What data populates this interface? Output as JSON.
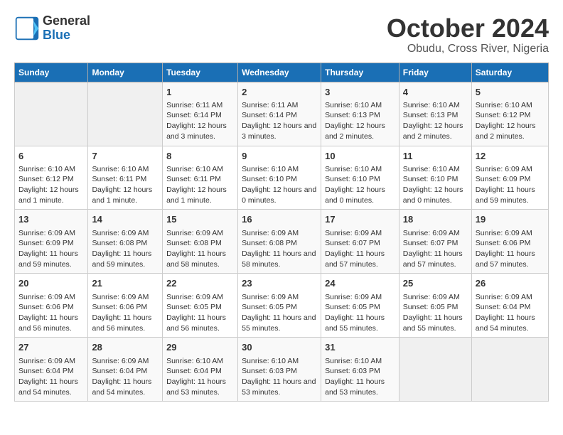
{
  "header": {
    "logo_line1": "General",
    "logo_line2": "Blue",
    "month": "October 2024",
    "location": "Obudu, Cross River, Nigeria"
  },
  "weekdays": [
    "Sunday",
    "Monday",
    "Tuesday",
    "Wednesday",
    "Thursday",
    "Friday",
    "Saturday"
  ],
  "weeks": [
    [
      {
        "day": "",
        "info": ""
      },
      {
        "day": "",
        "info": ""
      },
      {
        "day": "1",
        "info": "Sunrise: 6:11 AM\nSunset: 6:14 PM\nDaylight: 12 hours and 3 minutes."
      },
      {
        "day": "2",
        "info": "Sunrise: 6:11 AM\nSunset: 6:14 PM\nDaylight: 12 hours and 3 minutes."
      },
      {
        "day": "3",
        "info": "Sunrise: 6:10 AM\nSunset: 6:13 PM\nDaylight: 12 hours and 2 minutes."
      },
      {
        "day": "4",
        "info": "Sunrise: 6:10 AM\nSunset: 6:13 PM\nDaylight: 12 hours and 2 minutes."
      },
      {
        "day": "5",
        "info": "Sunrise: 6:10 AM\nSunset: 6:12 PM\nDaylight: 12 hours and 2 minutes."
      }
    ],
    [
      {
        "day": "6",
        "info": "Sunrise: 6:10 AM\nSunset: 6:12 PM\nDaylight: 12 hours and 1 minute."
      },
      {
        "day": "7",
        "info": "Sunrise: 6:10 AM\nSunset: 6:11 PM\nDaylight: 12 hours and 1 minute."
      },
      {
        "day": "8",
        "info": "Sunrise: 6:10 AM\nSunset: 6:11 PM\nDaylight: 12 hours and 1 minute."
      },
      {
        "day": "9",
        "info": "Sunrise: 6:10 AM\nSunset: 6:10 PM\nDaylight: 12 hours and 0 minutes."
      },
      {
        "day": "10",
        "info": "Sunrise: 6:10 AM\nSunset: 6:10 PM\nDaylight: 12 hours and 0 minutes."
      },
      {
        "day": "11",
        "info": "Sunrise: 6:10 AM\nSunset: 6:10 PM\nDaylight: 12 hours and 0 minutes."
      },
      {
        "day": "12",
        "info": "Sunrise: 6:09 AM\nSunset: 6:09 PM\nDaylight: 11 hours and 59 minutes."
      }
    ],
    [
      {
        "day": "13",
        "info": "Sunrise: 6:09 AM\nSunset: 6:09 PM\nDaylight: 11 hours and 59 minutes."
      },
      {
        "day": "14",
        "info": "Sunrise: 6:09 AM\nSunset: 6:08 PM\nDaylight: 11 hours and 59 minutes."
      },
      {
        "day": "15",
        "info": "Sunrise: 6:09 AM\nSunset: 6:08 PM\nDaylight: 11 hours and 58 minutes."
      },
      {
        "day": "16",
        "info": "Sunrise: 6:09 AM\nSunset: 6:08 PM\nDaylight: 11 hours and 58 minutes."
      },
      {
        "day": "17",
        "info": "Sunrise: 6:09 AM\nSunset: 6:07 PM\nDaylight: 11 hours and 57 minutes."
      },
      {
        "day": "18",
        "info": "Sunrise: 6:09 AM\nSunset: 6:07 PM\nDaylight: 11 hours and 57 minutes."
      },
      {
        "day": "19",
        "info": "Sunrise: 6:09 AM\nSunset: 6:06 PM\nDaylight: 11 hours and 57 minutes."
      }
    ],
    [
      {
        "day": "20",
        "info": "Sunrise: 6:09 AM\nSunset: 6:06 PM\nDaylight: 11 hours and 56 minutes."
      },
      {
        "day": "21",
        "info": "Sunrise: 6:09 AM\nSunset: 6:06 PM\nDaylight: 11 hours and 56 minutes."
      },
      {
        "day": "22",
        "info": "Sunrise: 6:09 AM\nSunset: 6:05 PM\nDaylight: 11 hours and 56 minutes."
      },
      {
        "day": "23",
        "info": "Sunrise: 6:09 AM\nSunset: 6:05 PM\nDaylight: 11 hours and 55 minutes."
      },
      {
        "day": "24",
        "info": "Sunrise: 6:09 AM\nSunset: 6:05 PM\nDaylight: 11 hours and 55 minutes."
      },
      {
        "day": "25",
        "info": "Sunrise: 6:09 AM\nSunset: 6:05 PM\nDaylight: 11 hours and 55 minutes."
      },
      {
        "day": "26",
        "info": "Sunrise: 6:09 AM\nSunset: 6:04 PM\nDaylight: 11 hours and 54 minutes."
      }
    ],
    [
      {
        "day": "27",
        "info": "Sunrise: 6:09 AM\nSunset: 6:04 PM\nDaylight: 11 hours and 54 minutes."
      },
      {
        "day": "28",
        "info": "Sunrise: 6:09 AM\nSunset: 6:04 PM\nDaylight: 11 hours and 54 minutes."
      },
      {
        "day": "29",
        "info": "Sunrise: 6:10 AM\nSunset: 6:04 PM\nDaylight: 11 hours and 53 minutes."
      },
      {
        "day": "30",
        "info": "Sunrise: 6:10 AM\nSunset: 6:03 PM\nDaylight: 11 hours and 53 minutes."
      },
      {
        "day": "31",
        "info": "Sunrise: 6:10 AM\nSunset: 6:03 PM\nDaylight: 11 hours and 53 minutes."
      },
      {
        "day": "",
        "info": ""
      },
      {
        "day": "",
        "info": ""
      }
    ]
  ]
}
